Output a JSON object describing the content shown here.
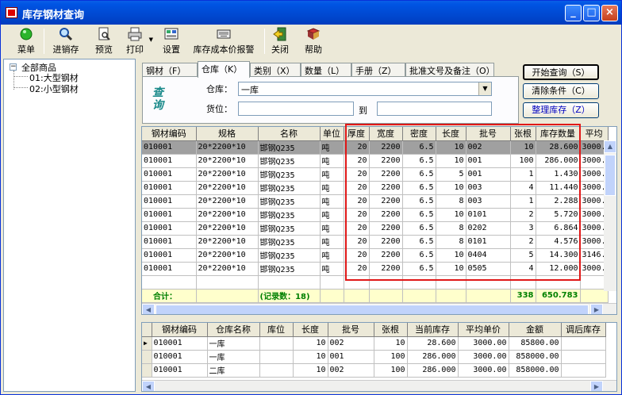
{
  "window": {
    "title": "库存钢材查询",
    "buttons": [
      "_",
      "□",
      "×"
    ]
  },
  "toolbar": [
    {
      "label": "菜单",
      "icon": "green-ball-icon"
    },
    {
      "label": "进销存",
      "icon": "magnifier-icon"
    },
    {
      "label": "预览",
      "icon": "preview-icon"
    },
    {
      "label": "打印",
      "icon": "printer-icon"
    },
    {
      "label": "设置",
      "icon": "settings-icon"
    },
    {
      "label": "库存成本价报警",
      "icon": "keyboard-icon"
    },
    {
      "label": "关闭",
      "icon": "exit-icon"
    },
    {
      "label": "帮助",
      "icon": "help-book-icon"
    }
  ],
  "tree": {
    "root": "全部商品",
    "children": [
      "01:大型钢材",
      "02:小型钢材"
    ]
  },
  "tabs": [
    "钢材（F）",
    "仓库（K）",
    "类别（X）",
    "数量（L）",
    "手册（Z）",
    "批准文号及备注（O）"
  ],
  "filter": {
    "side_label": "查询",
    "warehouse_label": "仓库：",
    "warehouse_value": "一库",
    "location_label": "货位：",
    "to_label": "到"
  },
  "actions": {
    "search": "开始查询（S）",
    "clear": "清除条件（C）",
    "tidy": "整理库存（Z）"
  },
  "main_table": {
    "headers": [
      "钢材编码",
      "规格",
      "名称",
      "单位",
      "厚度",
      "宽度",
      "密度",
      "长度",
      "批号",
      "张根",
      "库存数量",
      "平均"
    ],
    "rows": [
      [
        "010001",
        "20*2200*10",
        "邯钢Q235",
        "吨",
        "20",
        "2200",
        "6.5",
        "10",
        "002",
        "10",
        "28.600",
        "3000."
      ],
      [
        "010001",
        "20*2200*10",
        "邯钢Q235",
        "吨",
        "20",
        "2200",
        "6.5",
        "10",
        "001",
        "100",
        "286.000",
        "3000."
      ],
      [
        "010001",
        "20*2200*10",
        "邯钢Q235",
        "吨",
        "20",
        "2200",
        "6.5",
        "5",
        "001",
        "1",
        "1.430",
        "3000."
      ],
      [
        "010001",
        "20*2200*10",
        "邯钢Q235",
        "吨",
        "20",
        "2200",
        "6.5",
        "10",
        "003",
        "4",
        "11.440",
        "3000."
      ],
      [
        "010001",
        "20*2200*10",
        "邯钢Q235",
        "吨",
        "20",
        "2200",
        "6.5",
        "8",
        "003",
        "1",
        "2.288",
        "3000."
      ],
      [
        "010001",
        "20*2200*10",
        "邯钢Q235",
        "吨",
        "20",
        "2200",
        "6.5",
        "10",
        "0101",
        "2",
        "5.720",
        "3000."
      ],
      [
        "010001",
        "20*2200*10",
        "邯钢Q235",
        "吨",
        "20",
        "2200",
        "6.5",
        "8",
        "0202",
        "3",
        "6.864",
        "3000."
      ],
      [
        "010001",
        "20*2200*10",
        "邯钢Q235",
        "吨",
        "20",
        "2200",
        "6.5",
        "8",
        "0101",
        "2",
        "4.576",
        "3000."
      ],
      [
        "010001",
        "20*2200*10",
        "邯钢Q235",
        "吨",
        "20",
        "2200",
        "6.5",
        "10",
        "0404",
        "5",
        "14.300",
        "3146."
      ],
      [
        "010001",
        "20*2200*10",
        "邯钢Q235",
        "吨",
        "20",
        "2200",
        "6.5",
        "10",
        "0505",
        "4",
        "12.000",
        "3000."
      ]
    ],
    "summary": {
      "label": "合计：",
      "count": "(记录数：18)",
      "sheets": "338",
      "qty": "650.783"
    }
  },
  "detail_table": {
    "headers": [
      "钢材编码",
      "仓库名称",
      "库位",
      "长度",
      "批号",
      "张根",
      "当前库存",
      "平均单价",
      "金额",
      "调后库存"
    ],
    "rows": [
      [
        "010001",
        "一库",
        "",
        "10",
        "002",
        "10",
        "28.600",
        "3000.00",
        "85800.00",
        ""
      ],
      [
        "010001",
        "一库",
        "",
        "10",
        "001",
        "100",
        "286.000",
        "3000.00",
        "858000.00",
        ""
      ],
      [
        "010001",
        "二库",
        "",
        "10",
        "002",
        "100",
        "286.000",
        "3000.00",
        "858000.00",
        ""
      ]
    ]
  },
  "colors": {
    "title_bar": "#0054e3",
    "highlight_box": "#e01818",
    "summary_text": "#008000",
    "selected_row": "#a0a0a0"
  }
}
